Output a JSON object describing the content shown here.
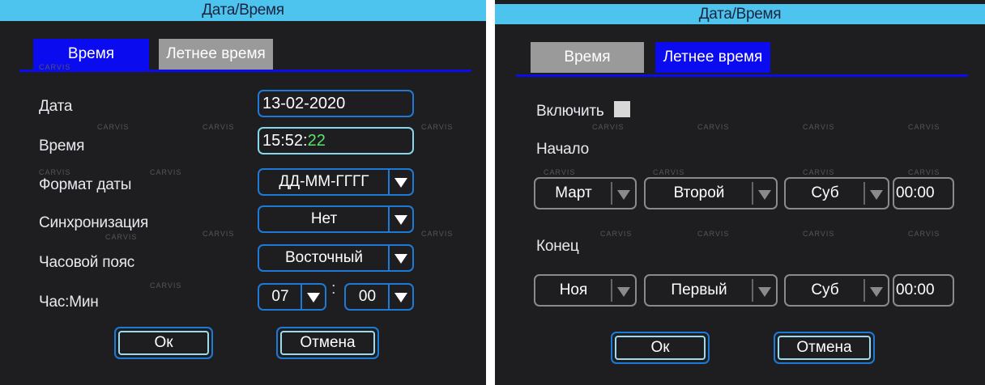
{
  "left": {
    "title": "Дата/Время",
    "tabs": [
      {
        "label": "Время",
        "active": true
      },
      {
        "label": "Летнее время",
        "active": false
      }
    ],
    "date": {
      "label": "Дата",
      "value": "13-02-2020"
    },
    "time": {
      "label": "Время",
      "value_main": "15:52:",
      "value_seconds": "22"
    },
    "date_format": {
      "label": "Формат даты",
      "value": "ДД-ММ-ГГГГ"
    },
    "sync": {
      "label": "Синхронизация",
      "value": "Нет"
    },
    "timezone": {
      "label": "Часовой пояс",
      "value": "Восточный"
    },
    "hourmin": {
      "label": "Час:Мин",
      "hour": "07",
      "separator": ":",
      "minute": "00"
    },
    "ok_label": "Ок",
    "cancel_label": "Отмена"
  },
  "right": {
    "title": "Дата/Время",
    "tabs": [
      {
        "label": "Время",
        "active": false
      },
      {
        "label": "Летнее время",
        "active": true
      }
    ],
    "enable_label": "Включить",
    "start": {
      "label": "Начало",
      "month": "Март",
      "week": "Второй",
      "day": "Суб",
      "time": "00:00"
    },
    "end": {
      "label": "Конец",
      "month": "Ноя",
      "week": "Первый",
      "day": "Суб",
      "time": "00:00"
    },
    "ok_label": "Ок",
    "cancel_label": "Отмена"
  },
  "watermark": "CARVIS",
  "colors": {
    "title_bar": "#4dc4ee",
    "active_tab": "#0b0bf0",
    "field_border": "#1d7ad6",
    "seconds": "#58e36a"
  }
}
